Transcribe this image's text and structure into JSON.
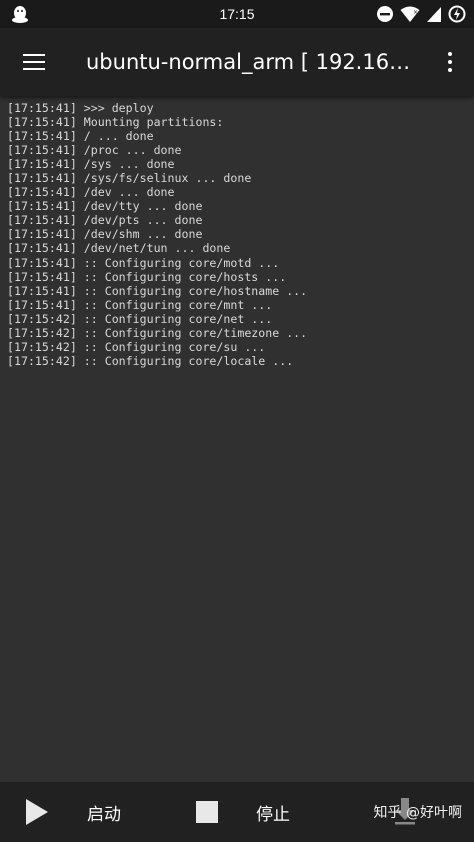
{
  "status_bar": {
    "time": "17:15",
    "icons": [
      "qq-penguin-icon",
      "do-not-disturb-icon",
      "wifi-icon",
      "signal-icon",
      "battery-charging-icon"
    ]
  },
  "app_bar": {
    "title": "ubuntu-normal_arm  [ 192.168...",
    "menu_icon": "hamburger-menu-icon",
    "more_icon": "more-vertical-icon"
  },
  "log": {
    "lines": [
      "[17:15:41] >>> deploy",
      "[17:15:41] Mounting partitions:",
      "[17:15:41] / ... done",
      "[17:15:41] /proc ... done",
      "[17:15:41] /sys ... done",
      "[17:15:41] /sys/fs/selinux ... done",
      "[17:15:41] /dev ... done",
      "[17:15:41] /dev/tty ... done",
      "[17:15:41] /dev/pts ... done",
      "[17:15:41] /dev/shm ... done",
      "[17:15:41] /dev/net/tun ... done",
      "[17:15:41] :: Configuring core/motd ...",
      "[17:15:41] :: Configuring core/hosts ...",
      "[17:15:41] :: Configuring core/hostname ...",
      "[17:15:41] :: Configuring core/mnt ...",
      "[17:15:42] :: Configuring core/net ...",
      "[17:15:42] :: Configuring core/timezone ...",
      "[17:15:42] :: Configuring core/su ...",
      "[17:15:42] :: Configuring core/locale ..."
    ]
  },
  "bottom_bar": {
    "start_label": "启动",
    "stop_label": "停止",
    "watermark": "知乎 @好叶啊"
  },
  "colors": {
    "background": "#303030",
    "toolbar": "#212121",
    "status_bar": "#1a1a1a",
    "log_text": "#d8d8d8"
  }
}
